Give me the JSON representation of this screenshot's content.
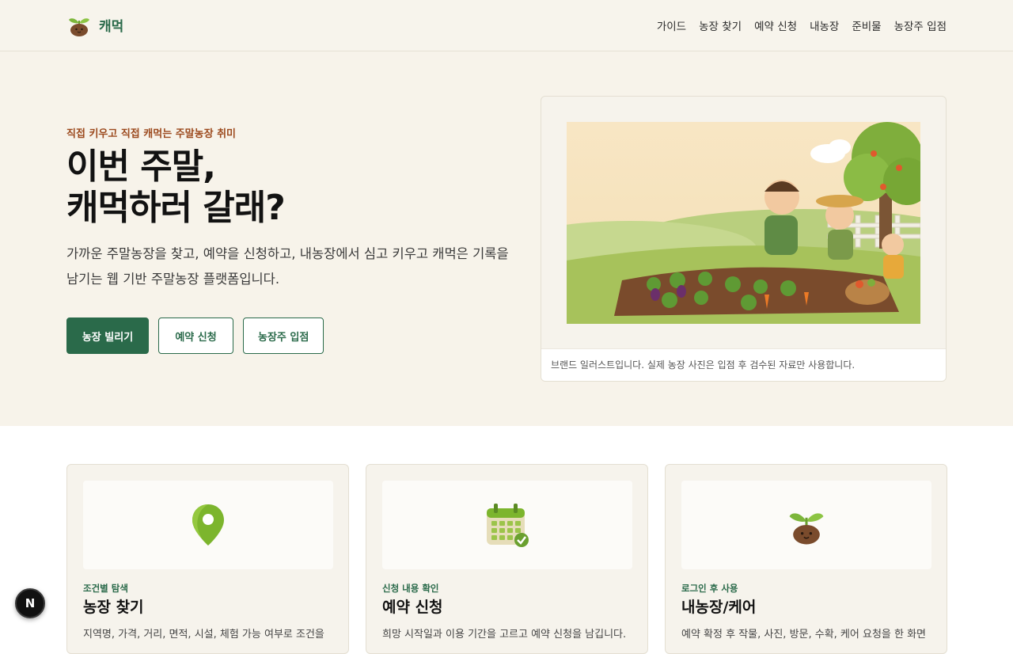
{
  "header": {
    "brand": {
      "name": "캐먹",
      "logo_icon": "sprout-pot-icon"
    },
    "nav": [
      "가이드",
      "농장 찾기",
      "예약 신청",
      "내농장",
      "준비물",
      "농장주 입점"
    ]
  },
  "hero": {
    "eyebrow": "직접 키우고 직접 캐먹는 주말농장 취미",
    "headline_line1": "이번 주말,",
    "headline_line2": "캐먹하러 갈래?",
    "lead": "가까운 주말농장을 찾고, 예약을 신청하고, 내농장에서 심고 키우고 캐먹은 기록을 남기는 웹 기반 주말농장 플랫폼입니다.",
    "buttons": {
      "primary": "농장 빌리기",
      "reserve": "예약 신청",
      "owner": "농장주 입점"
    },
    "image_caption": "브랜드 일러스트입니다. 실제 농장 사진은 입점 후 검수된 자료만 사용합니다."
  },
  "features": [
    {
      "icon": "map-pin-icon",
      "tag": "조건별 탐색",
      "title": "농장 찾기",
      "desc": "지역명, 가격, 거리, 면적, 시설, 체험 가능 여부로 조건을"
    },
    {
      "icon": "calendar-check-icon",
      "tag": "신청 내용 확인",
      "title": "예약 신청",
      "desc": "희망 시작일과 이용 기간을 고르고 예약 신청을 남깁니다."
    },
    {
      "icon": "sprout-pot-icon",
      "tag": "로그인 후 사용",
      "title": "내농장/케어",
      "desc": "예약 확정 후 작물, 사진, 방문, 수확, 케어 요청을 한 화면"
    }
  ],
  "dev_badge": "N",
  "colors": {
    "brand_green": "#2a6a4a",
    "eyebrow_brown": "#9c4a1e",
    "hero_bg": "#f7f3ea"
  }
}
